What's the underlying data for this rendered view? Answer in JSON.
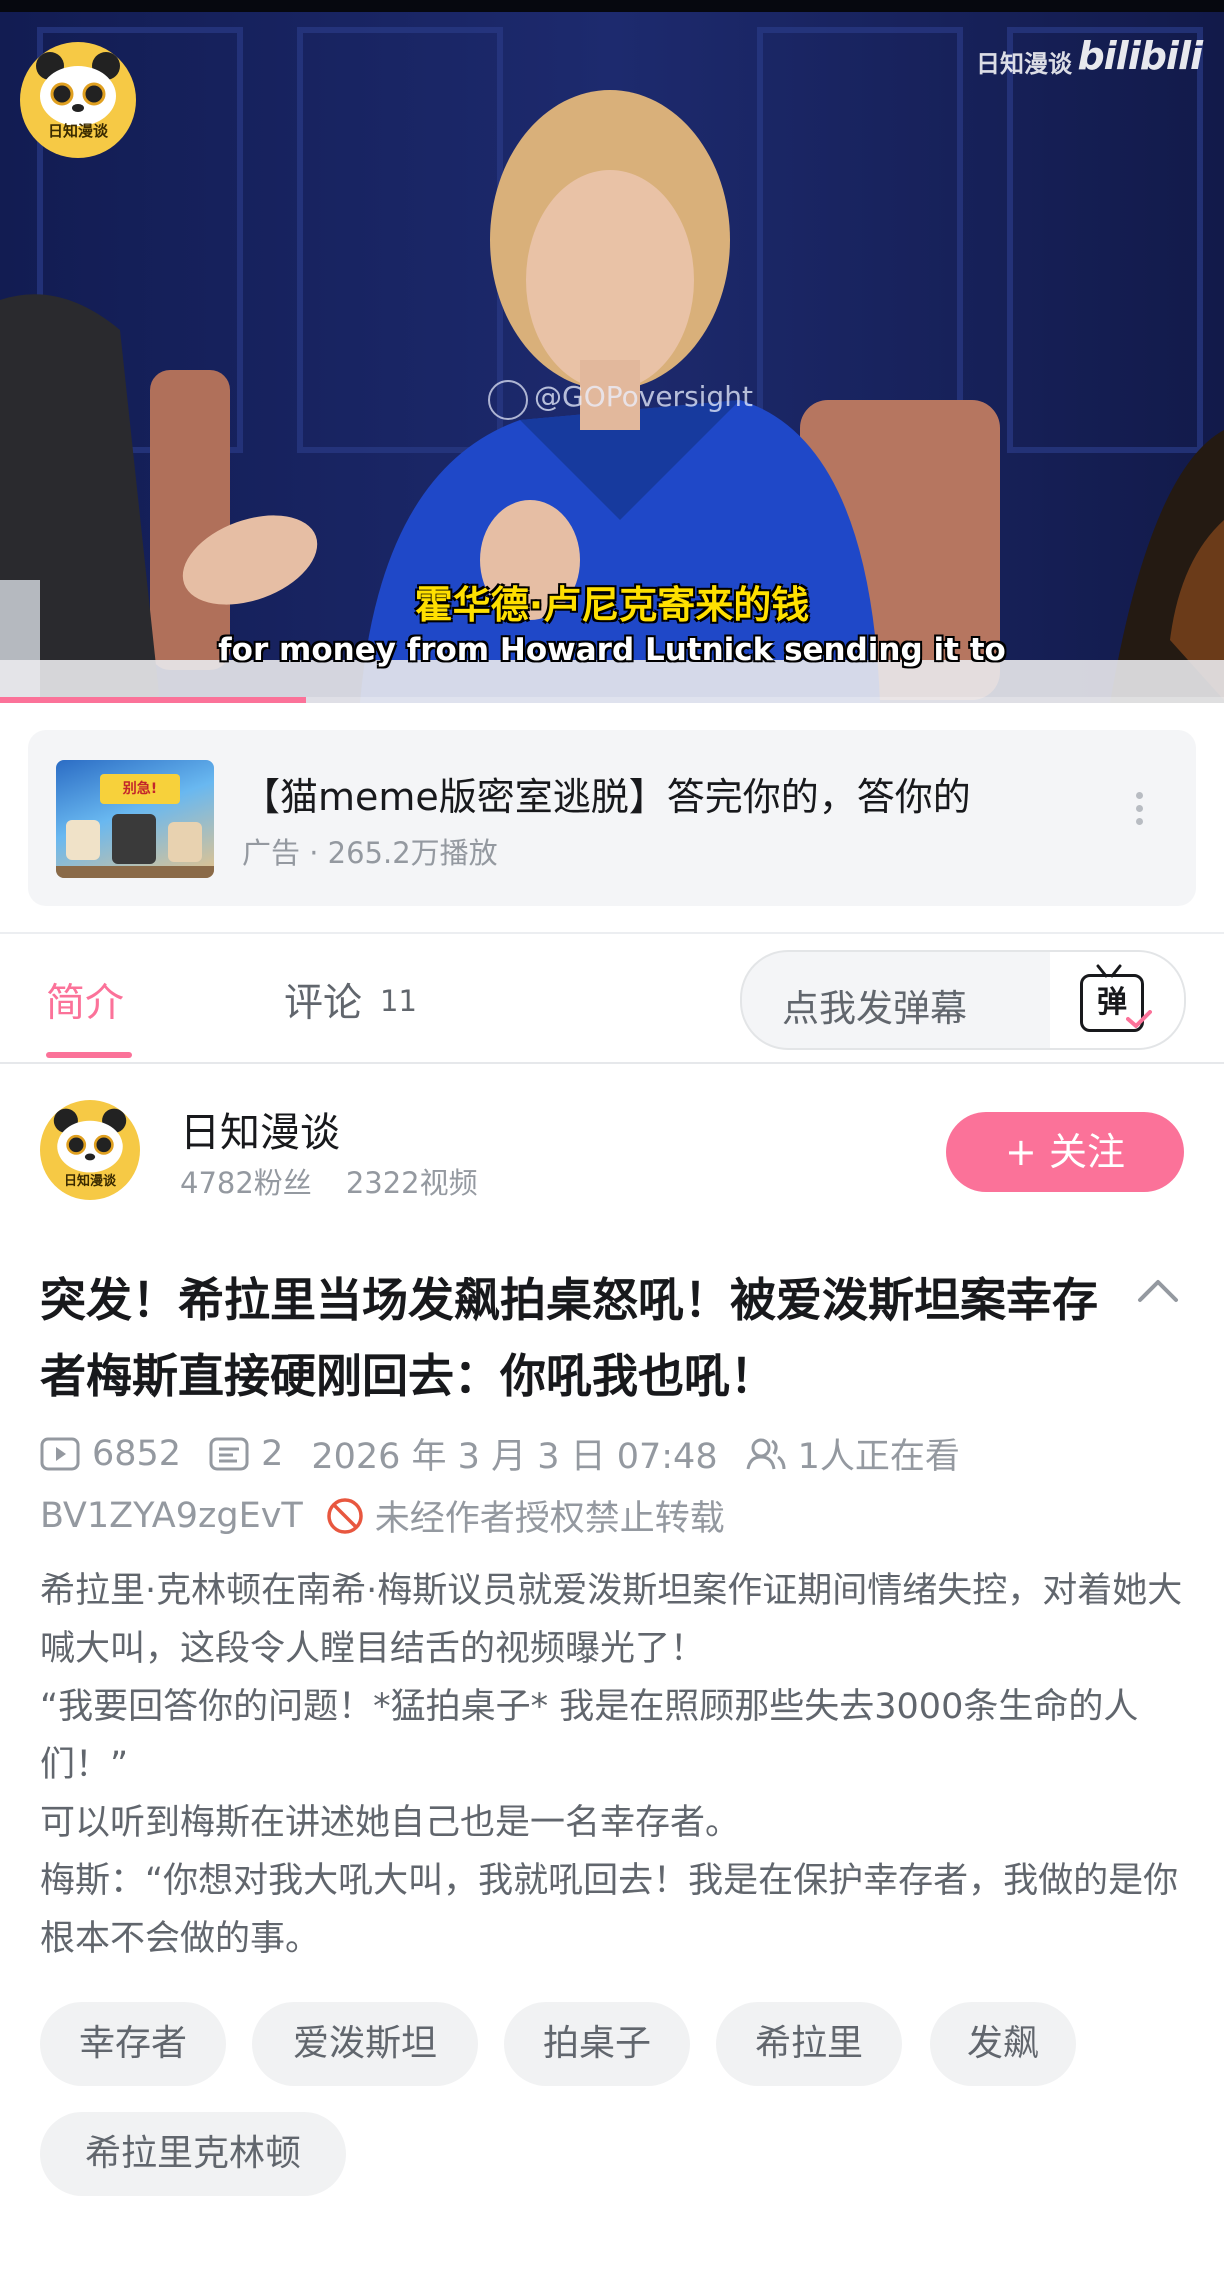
{
  "player": {
    "channel_logo_text": "日知漫谈",
    "watermark_text": "日知漫谈",
    "watermark_brand": "bilibili",
    "overlay_handle": "@GOPoversight",
    "subtitle_cn": "霍华德·卢尼克寄来的钱",
    "subtitle_en": "for money from Howard Lutnick sending it to",
    "progress_fraction": 0.25
  },
  "ad": {
    "title": "【猫meme版密室逃脱】答完你的，答你的",
    "meta": "广告 · 265.2万播放",
    "thumb_text": "别急!"
  },
  "tabs": {
    "intro_label": "简介",
    "comments_label": "评论",
    "comments_count": "11",
    "danmaku_placeholder": "点我发弹幕",
    "danmaku_icon_char": "弹"
  },
  "uploader": {
    "name": "日知漫谈",
    "fans": "4782粉丝",
    "videos": "2322视频",
    "follow_label": "+ 关注",
    "avatar_text": "日知漫谈"
  },
  "video": {
    "title": "突发！希拉里当场发飙拍桌怒吼！被爱泼斯坦案幸存者梅斯直接硬刚回去：你吼我也吼！",
    "views": "6852",
    "danmaku_count": "2",
    "date": "2026 年 3 月 3 日 07:48",
    "watching": "1人正在看",
    "bvid": "BV1ZYA9zgEvT",
    "copyright_notice": "未经作者授权禁止转载",
    "description": [
      "希拉里·克林顿在南希·梅斯议员就爱泼斯坦案作证期间情绪失控，对着她大喊大叫，这段令人瞠目结舌的视频曝光了！",
      "“我要回答你的问题！*猛拍桌子* 我是在照顾那些失去3000条生命的人们！”",
      "可以听到梅斯在讲述她自己也是一名幸存者。",
      "梅斯：“你想对我大吼大叫，我就吼回去！我是在保护幸存者，我做的是你根本不会做的事。"
    ],
    "tags": [
      "幸存者",
      "爱泼斯坦",
      "拍桌子",
      "希拉里",
      "发飙",
      "希拉里克林顿"
    ]
  },
  "colors": {
    "accent_pink": "#fb7299",
    "subtitle_yellow": "#ffe000",
    "text_primary": "#18191c",
    "text_secondary": "#61666d",
    "text_muted": "#9499a0"
  },
  "icons": [
    "play-count-icon",
    "danmaku-count-icon",
    "watching-icon",
    "no-repost-icon",
    "collapse-chevron-icon",
    "danmaku-toggle-icon",
    "more-vertical-icon"
  ]
}
